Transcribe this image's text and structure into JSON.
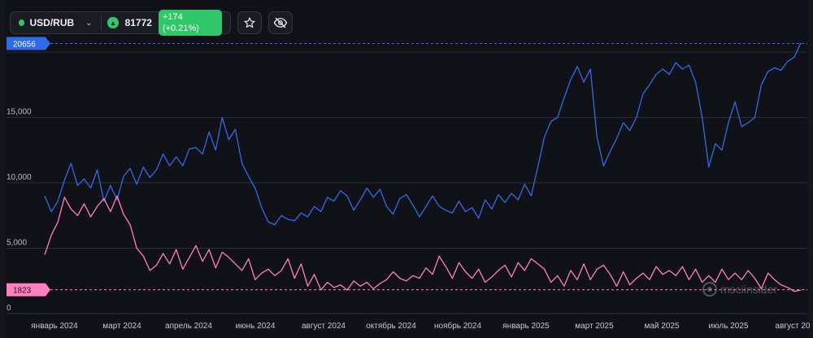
{
  "header": {
    "symbol": "USD/RUB",
    "chevron_icon": "chevron-down-icon",
    "price": "81772",
    "change": "+174 (+0.21%)",
    "star_icon": "star-icon",
    "visibility_icon": "eye-off-icon",
    "status_color": "#2fc76a",
    "up_color": "#2fc76a"
  },
  "watermark": "msciinsider",
  "colors": {
    "blue": "#2f6be8",
    "pink": "#ff7fc0"
  },
  "chart_data": {
    "type": "line",
    "x_labels": [
      "январь 2024",
      "март 2024",
      "апрель 2024",
      "июнь 2024",
      "август 2024",
      "октябрь 2024",
      "ноябрь 2024",
      "январь 2025",
      "март 2025",
      "май 2025",
      "июль 2025",
      "август 20"
    ],
    "y_ticks": [
      "0",
      "5,000",
      "10,000",
      "15,000"
    ],
    "ylim": [
      0,
      21000
    ],
    "grid": true,
    "markers": [
      {
        "label": "20656",
        "value": 20656,
        "color": "#2f6be8"
      },
      {
        "label": "1823",
        "value": 1823,
        "color": "#ff7fc0"
      }
    ],
    "series": [
      {
        "color": "#2f6be8",
        "values": [
          9000,
          7800,
          8600,
          10200,
          11500,
          9800,
          10300,
          9600,
          11000,
          8600,
          9800,
          8700,
          10500,
          11100,
          9900,
          11200,
          10400,
          11000,
          12200,
          11300,
          12000,
          11300,
          12600,
          12700,
          12200,
          13900,
          12500,
          15000,
          13300,
          14100,
          11500,
          10500,
          9600,
          8100,
          7000,
          6800,
          7500,
          7200,
          7100,
          7700,
          7400,
          8200,
          7800,
          8900,
          8600,
          9400,
          9000,
          7900,
          8700,
          9600,
          8900,
          9500,
          8200,
          7600,
          8800,
          9100,
          8300,
          7400,
          8200,
          9000,
          8200,
          7900,
          7700,
          8600,
          7800,
          8100,
          7300,
          8700,
          8000,
          9100,
          8500,
          9200,
          8700,
          9900,
          9000,
          11200,
          13500,
          14700,
          15000,
          16500,
          17900,
          18900,
          17700,
          18700,
          13500,
          11300,
          12400,
          13400,
          14600,
          14000,
          15000,
          16800,
          17500,
          18300,
          18700,
          18300,
          19200,
          18700,
          19000,
          17700,
          15000,
          11200,
          13000,
          12500,
          14600,
          16200,
          14300,
          14600,
          15000,
          17500,
          18500,
          18800,
          18600,
          19300,
          19600,
          20700
        ]
      },
      {
        "color": "#ff7fc0",
        "values": [
          4500,
          6000,
          7000,
          8900,
          8000,
          7500,
          8400,
          7400,
          8200,
          8800,
          7800,
          9000,
          7600,
          6800,
          5000,
          4400,
          3300,
          3700,
          4600,
          3800,
          4900,
          3400,
          4300,
          5200,
          4000,
          4900,
          3500,
          4700,
          4300,
          3800,
          3300,
          4200,
          2600,
          3100,
          3400,
          2900,
          3300,
          4200,
          2700,
          3800,
          2100,
          3000,
          1800,
          2400,
          2000,
          2200,
          1800,
          2500,
          2100,
          2400,
          1900,
          2300,
          2600,
          3200,
          2700,
          2500,
          2900,
          2700,
          3500,
          3000,
          4400,
          3600,
          2700,
          3900,
          3200,
          2700,
          3400,
          2400,
          2800,
          3300,
          3700,
          2800,
          3900,
          3300,
          4200,
          3800,
          3400,
          2400,
          2900,
          2100,
          3300,
          2600,
          3800,
          2600,
          3400,
          3700,
          3000,
          2100,
          3200,
          2200,
          2700,
          3100,
          2600,
          3600,
          3000,
          3300,
          2900,
          3600,
          2600,
          3400,
          2400,
          2900,
          2400,
          3400,
          2600,
          3100,
          2600,
          3300,
          2700,
          1900,
          3100,
          2600,
          2200,
          2000,
          1700,
          1800
        ]
      }
    ]
  }
}
